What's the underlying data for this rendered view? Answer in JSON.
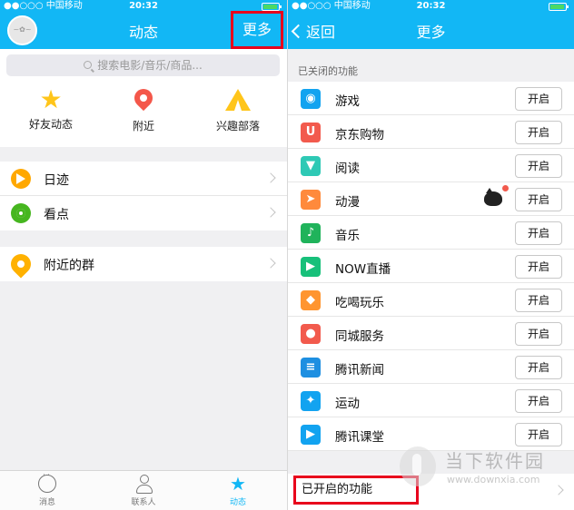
{
  "left": {
    "status": {
      "carrier": "●●○○○ 中国移动",
      "time": "20:32"
    },
    "nav": {
      "title": "动态",
      "more": "更多"
    },
    "search": {
      "placeholder": "搜索电影/音乐/商品..."
    },
    "quick": [
      {
        "label": "好友动态",
        "icon": "star-icon"
      },
      {
        "label": "附近",
        "icon": "location-pin-icon"
      },
      {
        "label": "兴趣部落",
        "icon": "tent-icon"
      }
    ],
    "group1": [
      {
        "label": "日迹",
        "icon": "play-circle-icon",
        "color": "#ffa800"
      },
      {
        "label": "看点",
        "icon": "eye-icon",
        "color": "#46b61f"
      }
    ],
    "group2": [
      {
        "label": "附近的群",
        "icon": "group-pin-icon",
        "color": "#ffb100"
      }
    ],
    "tabs": [
      {
        "label": "消息",
        "icon": "chat-bubble-icon"
      },
      {
        "label": "联系人",
        "icon": "person-icon"
      },
      {
        "label": "动态",
        "icon": "star-icon",
        "active": true
      }
    ]
  },
  "right": {
    "status": {
      "carrier": "●●○○○ 中国移动",
      "time": "20:32"
    },
    "nav": {
      "back": "返回",
      "title": "更多"
    },
    "closed_header": "已关闭的功能",
    "features": [
      {
        "name": "游戏",
        "icon": "gamepad-icon",
        "color": "#12a3f0",
        "button": "开启"
      },
      {
        "name": "京东购物",
        "icon": "jd-shopping-icon",
        "color": "#f25a4d",
        "button": "开启"
      },
      {
        "name": "阅读",
        "icon": "bookmark-icon",
        "color": "#2ec9b5",
        "button": "开启"
      },
      {
        "name": "动漫",
        "icon": "paper-plane-icon",
        "color": "#ff8a3c",
        "button": "开启"
      },
      {
        "name": "音乐",
        "icon": "music-leaf-icon",
        "color": "#20b35b",
        "button": "开启"
      },
      {
        "name": "NOW直播",
        "icon": "now-live-icon",
        "color": "#17c07a",
        "button": "开启"
      },
      {
        "name": "吃喝玩乐",
        "icon": "food-icon",
        "color": "#ff9530",
        "button": "开启"
      },
      {
        "name": "同城服务",
        "icon": "balloon-icon",
        "color": "#f25a4d",
        "button": "开启"
      },
      {
        "name": "腾讯新闻",
        "icon": "news-icon",
        "color": "#1e8fe1",
        "button": "开启"
      },
      {
        "name": "运动",
        "icon": "runner-icon",
        "color": "#12a3f0",
        "button": "开启"
      },
      {
        "name": "腾讯课堂",
        "icon": "classroom-icon",
        "color": "#12a3f0",
        "button": "开启"
      }
    ],
    "enabled_header": "已开启的功能"
  },
  "watermark": {
    "title": "当下软件园",
    "url": "www.downxia.com"
  },
  "colors": {
    "brand_blue": "#12b7f5",
    "highlight_red": "#e8001c"
  }
}
